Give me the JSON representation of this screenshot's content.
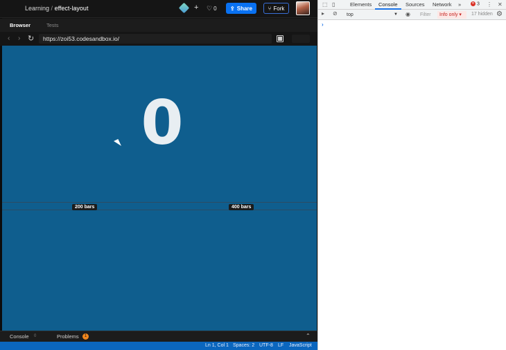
{
  "header": {
    "breadcrumb_parent": "Learning",
    "breadcrumb_separator": "/",
    "breadcrumb_project": "effect-layout",
    "like_count": "0",
    "share_label": "Share",
    "fork_label": "Fork"
  },
  "tabs": {
    "browser": "Browser",
    "tests": "Tests"
  },
  "address": {
    "url": "https://zoi53.codesandbox.io/"
  },
  "preview": {
    "counter": "0",
    "label_200": "200 bars",
    "label_400": "400 bars"
  },
  "devpanel": {
    "console_label": "Console",
    "console_count": "0",
    "problems_label": "Problems",
    "problems_count": "1"
  },
  "status": {
    "position": "Ln 1, Col 1",
    "spaces": "Spaces: 2",
    "encoding": "UTF-8",
    "eol": "LF",
    "language": "JavaScript"
  },
  "devtools": {
    "tabs": [
      "Elements",
      "Console",
      "Sources",
      "Network"
    ],
    "more": "»",
    "error_count": "3",
    "context": "top",
    "filter_placeholder": "Filter",
    "levels": "Info only ▾",
    "hidden": "17 hidden",
    "prompt": "›"
  },
  "colors": {
    "preview_bg": "#0f5e8e",
    "share_bg": "#0971f1",
    "status_bg": "#0b66be"
  }
}
